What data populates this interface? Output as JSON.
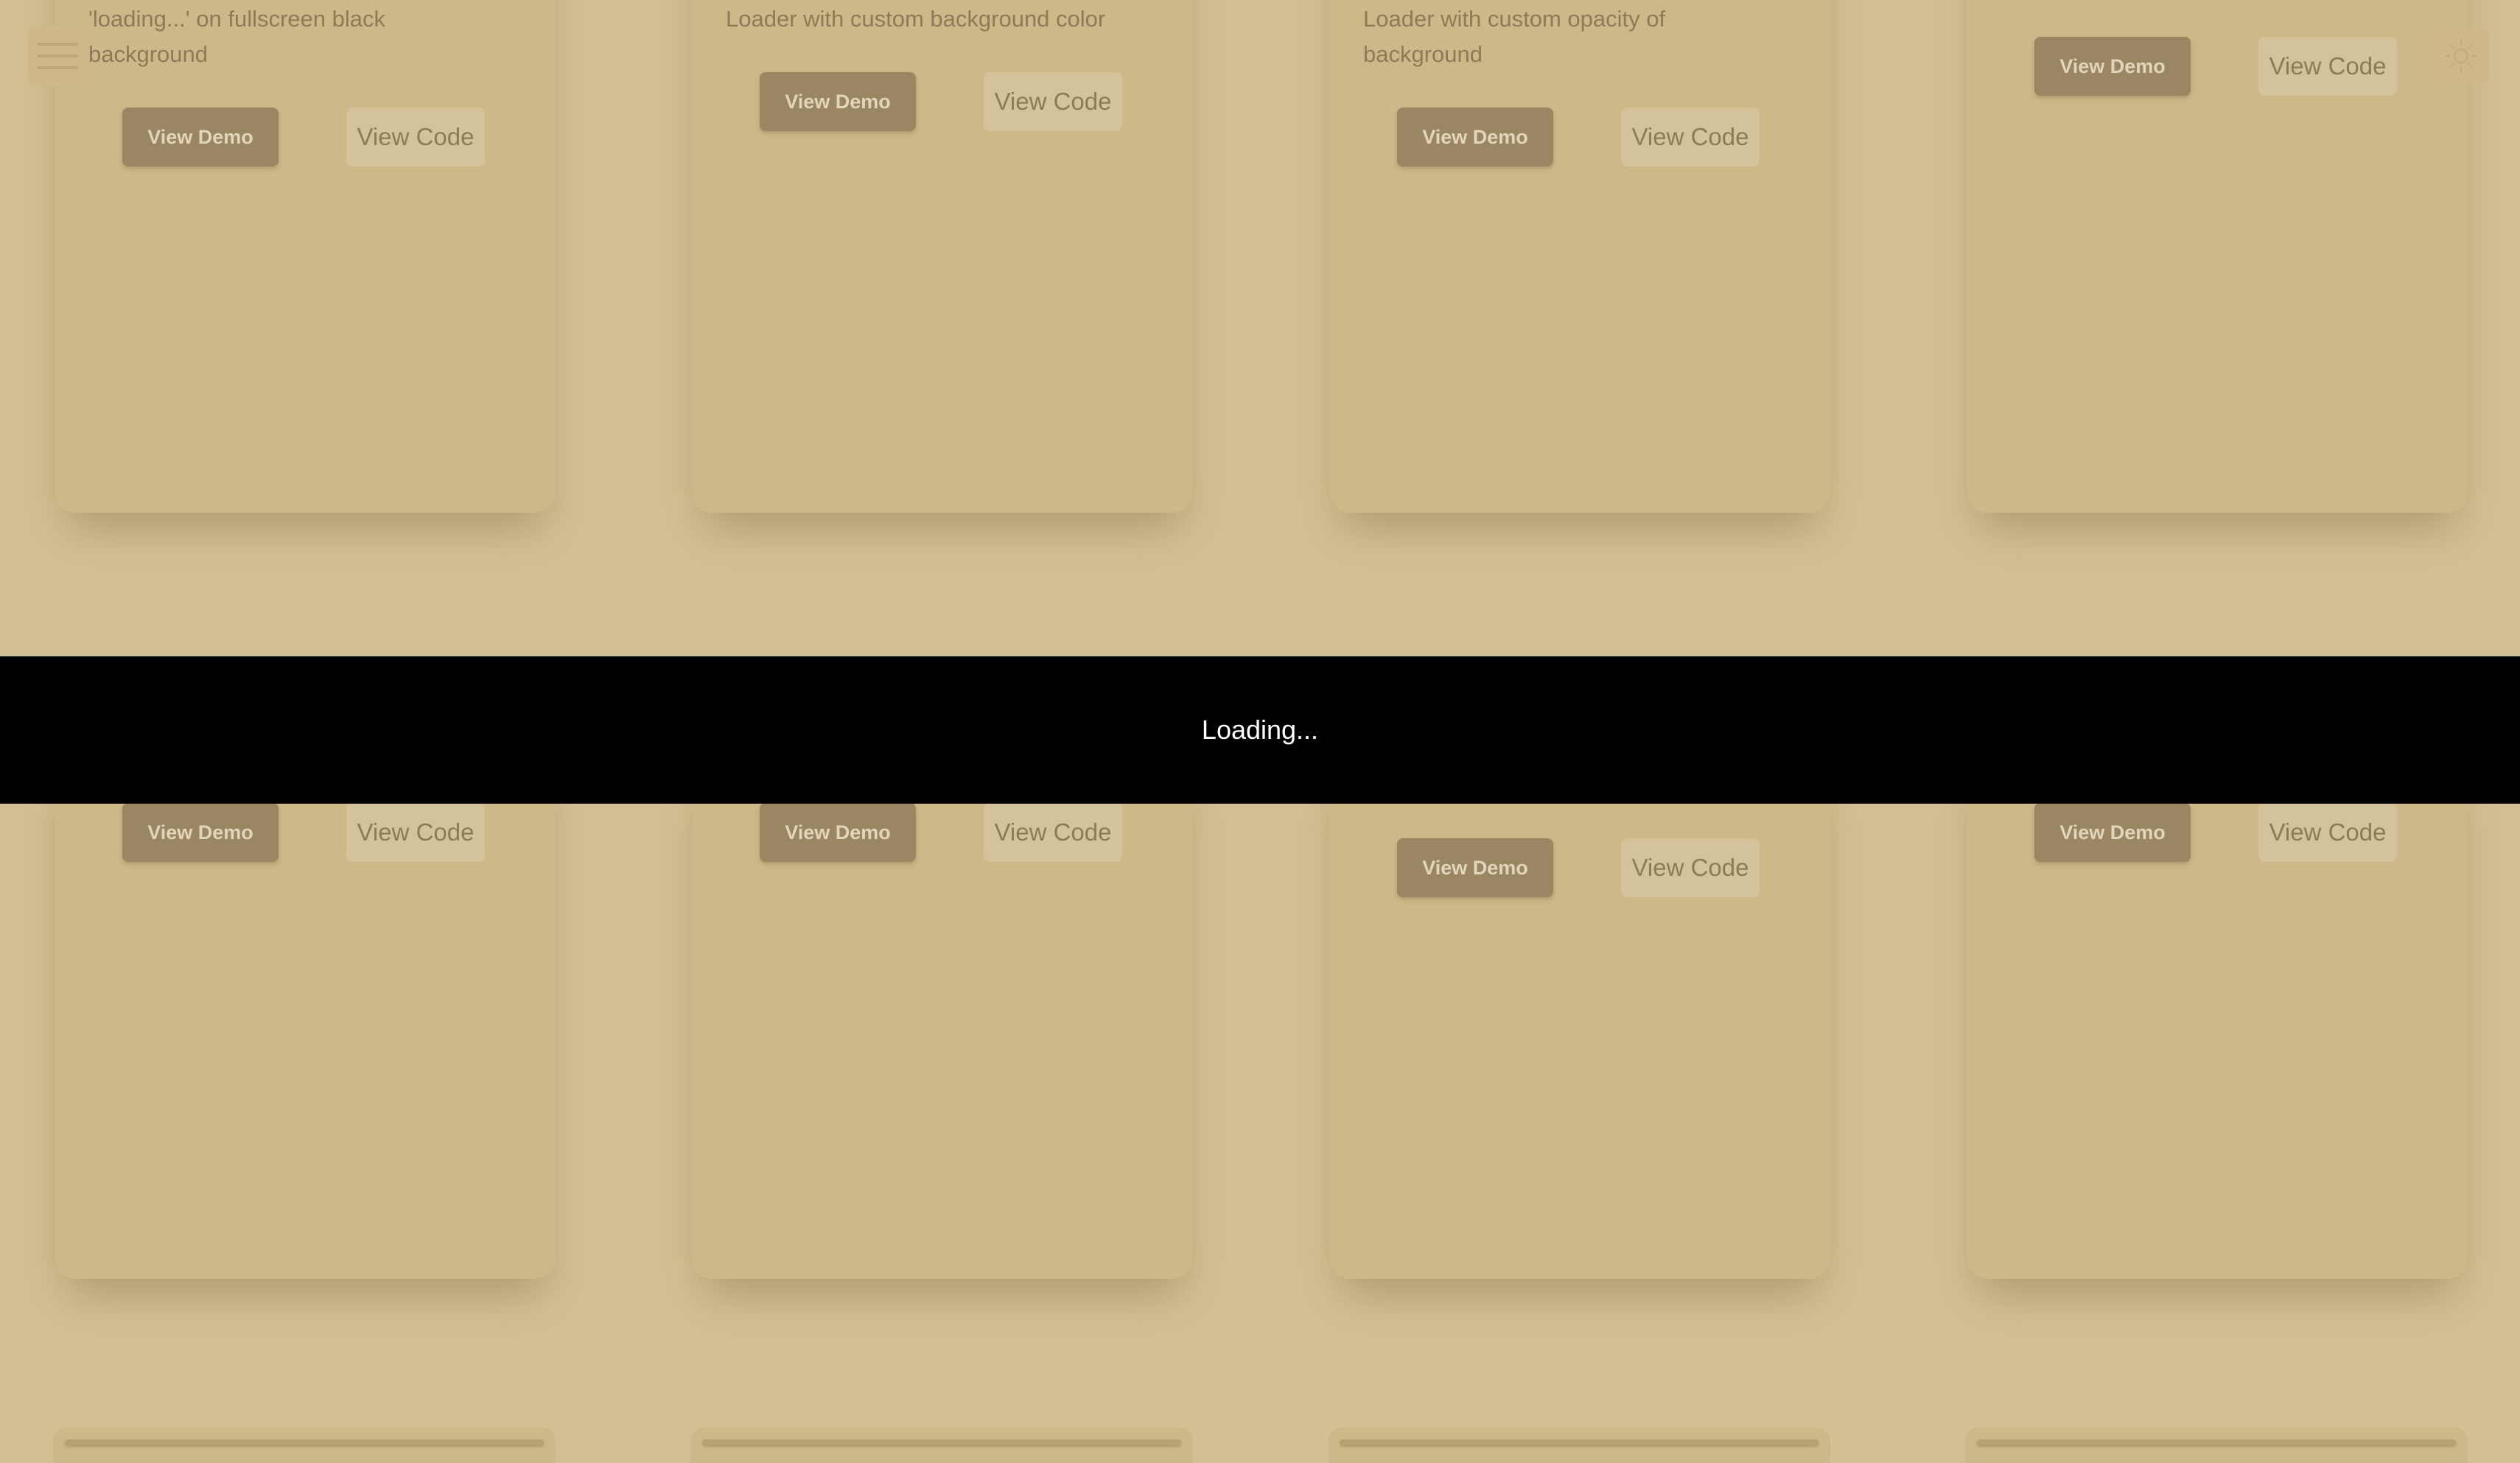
{
  "cards_top": [
    {
      "description": "'loading...' on fullscreen black\nbackground",
      "demo_label": "View Demo",
      "code_label": "View Code"
    },
    {
      "description": "Loader with custom background color",
      "demo_label": "View Demo",
      "code_label": "View Code"
    },
    {
      "description": "Loader with custom opacity of\nbackground",
      "demo_label": "View Demo",
      "code_label": "View Code"
    },
    {
      "description": "",
      "demo_label": "View Demo",
      "code_label": "View Code"
    }
  ],
  "cards_middle": [
    {
      "demo_label": "View Demo",
      "code_label": "View Code"
    },
    {
      "demo_label": "View Demo",
      "code_label": "View Code"
    },
    {
      "demo_label": "View Demo",
      "code_label": "View Code"
    },
    {
      "demo_label": "View Demo",
      "code_label": "View Code"
    }
  ],
  "overlay": {
    "text": "Loading..."
  },
  "icons": {
    "menu": "hamburger-menu-icon",
    "theme": "sun-icon"
  },
  "colors": {
    "page_background": "#d3bf93",
    "overlay_background": "#000000",
    "overlay_text": "#ffffff",
    "demo_button": "#9a8663",
    "code_button": "#d4c29b"
  }
}
